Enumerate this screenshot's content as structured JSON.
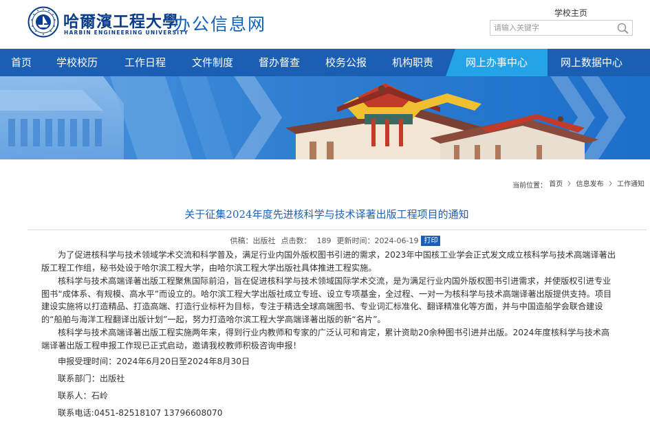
{
  "header": {
    "university_cn": "哈爾濱工程大學",
    "university_en": "HARBIN ENGINEERING UNIVERSITY",
    "site_title": "办公信息网",
    "home_link": "学校主页",
    "search_placeholder": "请输入关键字"
  },
  "nav": {
    "items": [
      {
        "label": "首页"
      },
      {
        "label": "学校校历"
      },
      {
        "label": "工作日程"
      },
      {
        "label": "文件制度"
      },
      {
        "label": "督办督查"
      },
      {
        "label": "校务公报"
      },
      {
        "label": "机构职责"
      },
      {
        "label": "网上办事中心"
      },
      {
        "label": "网上数据中心"
      }
    ],
    "active_color": "#24a3e6",
    "bar_color": "#1a5fb4"
  },
  "breadcrumb": {
    "prefix": "当前位置：",
    "items": [
      "首页",
      "信息发布",
      "工作通知"
    ]
  },
  "article": {
    "title": "关于征集2024年度先进核科学与技术译著出版工程项目的通知",
    "meta": {
      "source_label": "供稿：",
      "source": "出版社",
      "clicks_label": "点击数：",
      "clicks": "189",
      "updated_label": "更新时间：",
      "updated": "2024-06-19",
      "print_label": "打印"
    },
    "paragraphs": [
      "为了促进核科学与技术领域学术交流和科学普及，满足行业内国外版权图书引进的需求，2023年中国核工业学会正式发文成立核科学与技术高端译著出版工程工作组，秘书处设于哈尔滨工程大学，由哈尔滨工程大学出版社具体推进工程实施。",
      "核科学与技术高端译著出版工程聚焦国际前沿，旨在促进核科学与技术领域国际学术交流，是为满足行业内国外版权图书引进需求，并使版权引进专业图书“成体系、有规模、高水平”而设立的。哈尔滨工程大学出版社成立专班、设立专项基金，全过程、一对一为核科学与技术高端译著出版提供支持。项目建设实施将以打造精品、打造高端、打造行业标杆为目标，专注于精选全球高端图书、专业词汇标准化、翻译精准化等方面，并与中国造船学会联合建设的“船舶与海洋工程翻译出版计划”一起，努力打造哈尔滨工程大学高端译著出版的新“名片”。",
      "核科学与技术高端译著出版工程实施两年来，得到行业内教师和专家的广泛认可和肯定，累计资助20余种图书引进并出版。2024年度核科学与技术高端译著出版工程申报工作现已正式启动，邀请我校教师积极咨询申报！"
    ],
    "info": [
      "申报受理时间：2024年6月20日至2024年8月30日",
      "联系部门：出版社",
      "联系人：石岭",
      "联系电话:0451-82518107 13796608070"
    ]
  }
}
